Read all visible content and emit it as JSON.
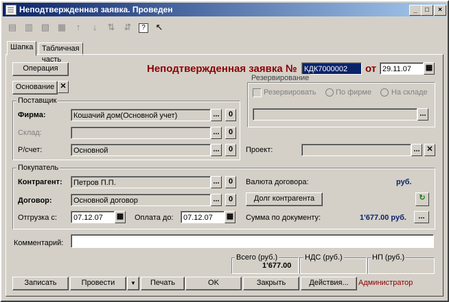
{
  "window": {
    "title": "Неподтвержденная заявка. Проведен"
  },
  "toolbar": {
    "icons": [
      "new-icon",
      "copy-icon",
      "delete-icon",
      "edit-icon",
      "arrow-up-icon",
      "arrow-down-icon",
      "sort-asc-icon",
      "sort-desc-icon",
      "help-icon",
      "context-help-icon"
    ]
  },
  "tabs": [
    {
      "label": "Шапка"
    },
    {
      "label": "Табличная часть"
    }
  ],
  "header": {
    "operation_label": "Операция",
    "basis_label": "Основание",
    "doc_title": "Неподтвержденная заявка №",
    "doc_number": "КДК7000002",
    "from_label": "от",
    "doc_date": "29.11.07"
  },
  "supplier": {
    "group_label": "Поставщик",
    "firm_label": "Фирма:",
    "firm_value": "Кошачий дом(Основной учет)",
    "warehouse_label": "Склад:",
    "warehouse_value": "",
    "account_label": "Р/счет:",
    "account_value": "Основной"
  },
  "reservation": {
    "group_label": "Резервирование",
    "reserve_label": "Резервировать",
    "by_firm_label": "По фирме",
    "in_warehouse_label": "На складе",
    "field_value": ""
  },
  "project": {
    "label": "Проект:",
    "value": ""
  },
  "buyer": {
    "group_label": "Покупатель",
    "counterparty_label": "Контрагент:",
    "counterparty_value": "Петров П.П.",
    "contract_label": "Договор:",
    "contract_value": "Основной договор",
    "shipment_label": "Отгрузка с:",
    "shipment_date": "07.12.07",
    "payment_label": "Оплата до:",
    "payment_date": "07.12.07",
    "currency_label": "Валюта договора:",
    "currency_value": "руб.",
    "debt_button": "Долг контрагента",
    "sum_label": "Сумма по документу:",
    "sum_value": "1'677.00 руб."
  },
  "comment": {
    "label": "Комментарий:",
    "value": ""
  },
  "totals": {
    "total_label": "Всего (руб.)",
    "total_value": "1'677.00",
    "vat_label": "НДС (руб.)",
    "vat_value": "",
    "np_label": "НП (руб.)",
    "np_value": ""
  },
  "buttons": {
    "save": "Записать",
    "post": "Провести",
    "print": "Печать",
    "ok": "OK",
    "close": "Закрыть",
    "actions": "Действия..."
  },
  "user": "Администратор",
  "colors": {
    "title_gradient_start": "#0a246a",
    "title_gradient_end": "#a6caf0",
    "doc_title": "#8b0000",
    "sum_value": "#0a246a"
  }
}
